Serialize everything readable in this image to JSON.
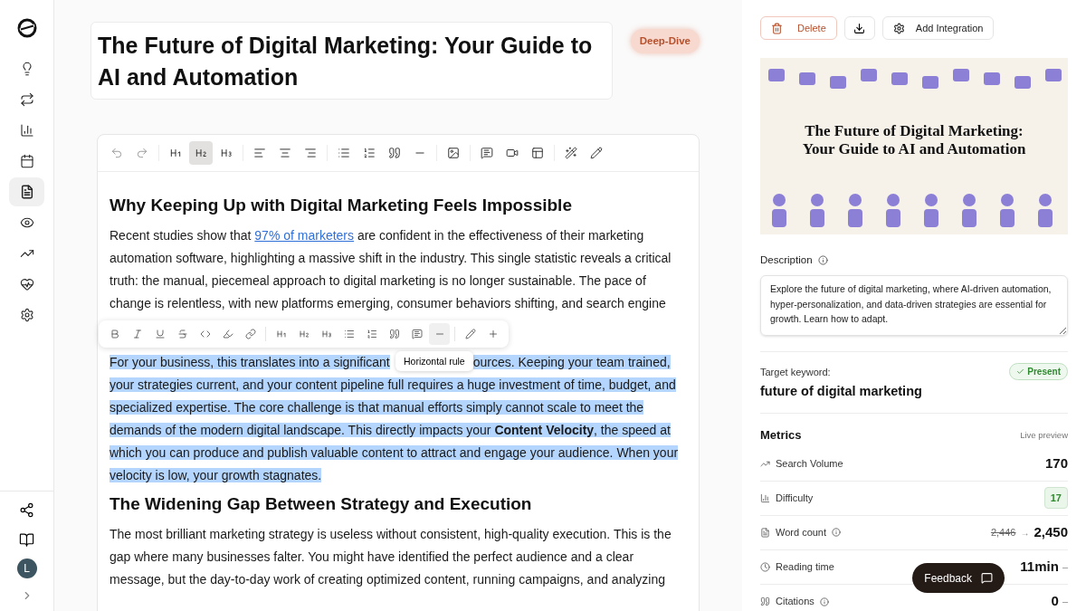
{
  "sidebar": {
    "nav": [
      {
        "selected": false
      },
      {
        "selected": false
      },
      {
        "selected": false
      },
      {
        "selected": false
      },
      {
        "selected": true
      },
      {
        "selected": false
      },
      {
        "selected": false
      },
      {
        "selected": false
      },
      {
        "selected": false
      }
    ],
    "avatar": "L"
  },
  "article": {
    "title": "The Future of Digital Marketing: Your Guide to AI and Automation",
    "badge": "Deep-Dive"
  },
  "main_toolbar": [
    {
      "selected": false
    },
    {
      "selected": false
    },
    {
      "selected": false
    },
    {
      "selected": true
    },
    {
      "selected": false
    },
    {
      "selected": false
    },
    {
      "selected": false
    },
    {
      "selected": false
    },
    {
      "selected": false
    },
    {
      "selected": false
    },
    {
      "selected": false
    },
    {
      "selected": false
    },
    {
      "selected": false
    },
    {
      "selected": false
    },
    {
      "selected": false
    },
    {
      "selected": false
    },
    {
      "selected": false
    },
    {
      "selected": false
    }
  ],
  "content": [
    {
      "kind": "heading",
      "text": "Why Keeping Up with Digital Marketing Feels Impossible"
    },
    {
      "kind": "paragraph",
      "selected": false,
      "before": "Recent studies show that ",
      "link": "97% of marketers",
      "after": " are confident in the effectiveness of their marketing automation software, highlighting a massive shift in the industry. This single statistic reveals a critical truth: the manual, piecemeal approach to digital marketing is no longer sustainable. The pace of change is relentless, with new platforms emerging, consumer behaviors shifting, and search engine"
    },
    {
      "kind": "bubble"
    },
    {
      "kind": "paragraph",
      "selected": true,
      "before": "For your business, this translates into a significant",
      "tooltip": "Horizontal rule",
      "after": "ources. Keeping your team trained, your strategies current, and your content pipeline full requires a huge investment of time, budget, and specialized expertise. The core challenge is that manual efforts simply cannot scale to meet the demands of the modern digital landscape. This directly impacts your **Content Velocity**, the speed at which you can produce and publish valuable content to attract and engage your audience. When your velocity is low, your growth stagnates."
    },
    {
      "kind": "heading",
      "text": "The Widening Gap Between Strategy and Execution"
    },
    {
      "kind": "paragraph",
      "selected": false,
      "before": "The most brilliant marketing strategy is useless without consistent, high-quality execution. This is the gap where many businesses falter. You might have identified the perfect audience and a clear message, but the day-to-day work of creating optimized content, running campaigns, and analyzing"
    }
  ],
  "bubble_toolbar": [
    {
      "hovered": false
    },
    {
      "hovered": false
    },
    {
      "hovered": false
    },
    {
      "hovered": false
    },
    {
      "hovered": false
    },
    {
      "hovered": false
    },
    {
      "hovered": false
    },
    {
      "hovered": false
    },
    {
      "hovered": false
    },
    {
      "hovered": false
    },
    {
      "hovered": false
    },
    {
      "hovered": false
    },
    {
      "hovered": false
    },
    {
      "hovered": false
    },
    {
      "hovered": true
    },
    {
      "hovered": false
    },
    {
      "hovered": false
    }
  ],
  "panel": {
    "delete": "Delete",
    "add_integration": "Add Integration",
    "cover_title": "The Future of Digital Marketing: Your Guide to AI and Automation",
    "description_label": "Description",
    "description": "Explore the future of digital marketing, where AI-driven automation, hyper-personalization, and data-driven strategies are essential for growth. Learn how to adapt.",
    "keyword_label": "Target keyword:",
    "keyword": "future of digital marketing",
    "keyword_status": "Present",
    "metrics_title": "Metrics",
    "metrics_note": "Live preview",
    "metrics": [
      {
        "kind": "number",
        "label": "Search Volume",
        "value": "170"
      },
      {
        "kind": "badge",
        "label": "Difficulty",
        "value": "17"
      },
      {
        "kind": "change",
        "label": "Word count",
        "info": true,
        "old": "2,446",
        "arrow": "→",
        "value": "2,450"
      },
      {
        "kind": "number",
        "label": "Reading time",
        "value": "11min",
        "trend": "–"
      },
      {
        "kind": "number",
        "label": "Citations",
        "info": true,
        "value": "0",
        "trend": "–"
      }
    ],
    "feedback": "Feedback"
  }
}
